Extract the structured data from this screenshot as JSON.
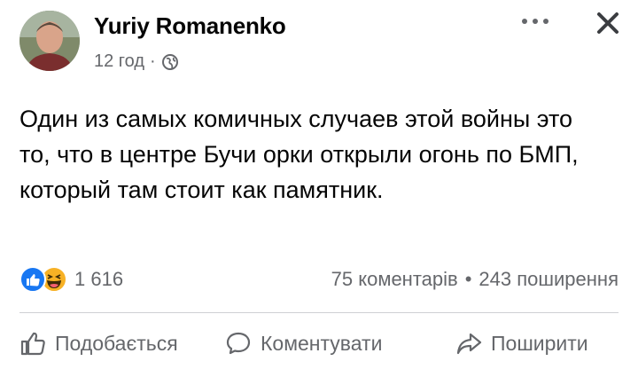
{
  "post": {
    "author": "Yuriy Romanenko",
    "time": "12 год",
    "separator": "·",
    "privacy_icon": "globe-icon",
    "text": "Один из самых комичных случаев этой войны это то, что в центре Бучи орки открыли огонь по БМП, который там стоит как памятник."
  },
  "stats": {
    "reactions": [
      "like-reaction",
      "haha-reaction"
    ],
    "reaction_count": "1 616",
    "comments": "75 коментарів",
    "stats_separator": "•",
    "shares": "243 поширення"
  },
  "actions": {
    "like": "Подобається",
    "comment": "Коментувати",
    "share": "Поширити"
  },
  "colors": {
    "text": "#050505",
    "secondary": "#65676b",
    "like_blue": "#1877f2",
    "haha_yellow": "#f7b125",
    "divider": "#ced0d4"
  }
}
